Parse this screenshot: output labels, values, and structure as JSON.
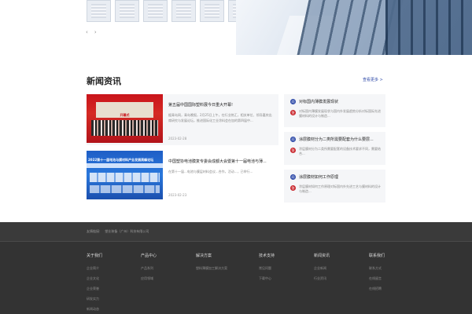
{
  "hero": {
    "certificates": [
      "certificate-1",
      "certificate-2",
      "certificate-3",
      "certificate-4",
      "certificate-5",
      "certificate-6"
    ],
    "prev_label": "‹",
    "next_label": "›"
  },
  "news": {
    "title": "新闻资讯",
    "more_label": "查看更多 >",
    "articles": [
      {
        "title": "第五届中国国际塑料展今日重大开幕!",
        "summary": "据青岛网，青岛晚报，2月25日上午，在行业热汇，相关单位、领导嘉宾出席研究与发展论坛，推进国际化工业涂料会在加的第四届中...",
        "date": "2023-02-28",
        "image_caption": "开幕式"
      },
      {
        "title": "中国塑协电池膜复专委会成都大会暨第十一届电池与薄...",
        "summary": "在第十一届...电池与膜层材料会议...合作，活动...，已举行...",
        "date": "2023-02-23",
        "image_caption": "2022第十一届电池与膜材料产业发展高峰论坛"
      }
    ],
    "faqs": [
      {
        "question": "对标国内薄膜发展现状",
        "answer": "对标国内薄膜发展现状与国内外发展趋势分析对标国际先进膜材料的设计与制造..."
      },
      {
        "question": "涂层膜材分为二类所需要配套为什么要层...",
        "answer": "涂层膜材分为二类所需要配套的设备技术要求不同，需要结合..."
      },
      {
        "question": "涂层膜材如何工作原理",
        "answer": "涂层膜材如何工作原理对标国内外先进工艺与膜材料的设计与制造..."
      }
    ],
    "q_mark": "问",
    "a_mark": "答"
  },
  "footer": {
    "friend_links_label": "友情链接:",
    "friend_links": [
      "塑业装备（广州）科技有限公司"
    ],
    "columns": [
      {
        "title": "关于我们",
        "links": [
          "企业简介",
          "企业文化",
          "企业荣誉",
          "研发实力",
          "新闻动态"
        ]
      },
      {
        "title": "产品中心",
        "links": [
          "产品系列",
          "应用领域"
        ]
      },
      {
        "title": "解决方案",
        "links": [
          "塑料薄膜加工解决方案"
        ]
      },
      {
        "title": "技术支持",
        "links": [
          "常见问题",
          "下载中心"
        ]
      },
      {
        "title": "新闻资讯",
        "links": [
          "企业新闻",
          "行业资讯"
        ]
      },
      {
        "title": "联系我们",
        "links": [
          "联系方式",
          "在线留言",
          "在线招聘"
        ]
      }
    ]
  },
  "colors": {
    "accent": "#2e4aa8",
    "answer": "#c9262c",
    "footer_bg": "#333333"
  }
}
